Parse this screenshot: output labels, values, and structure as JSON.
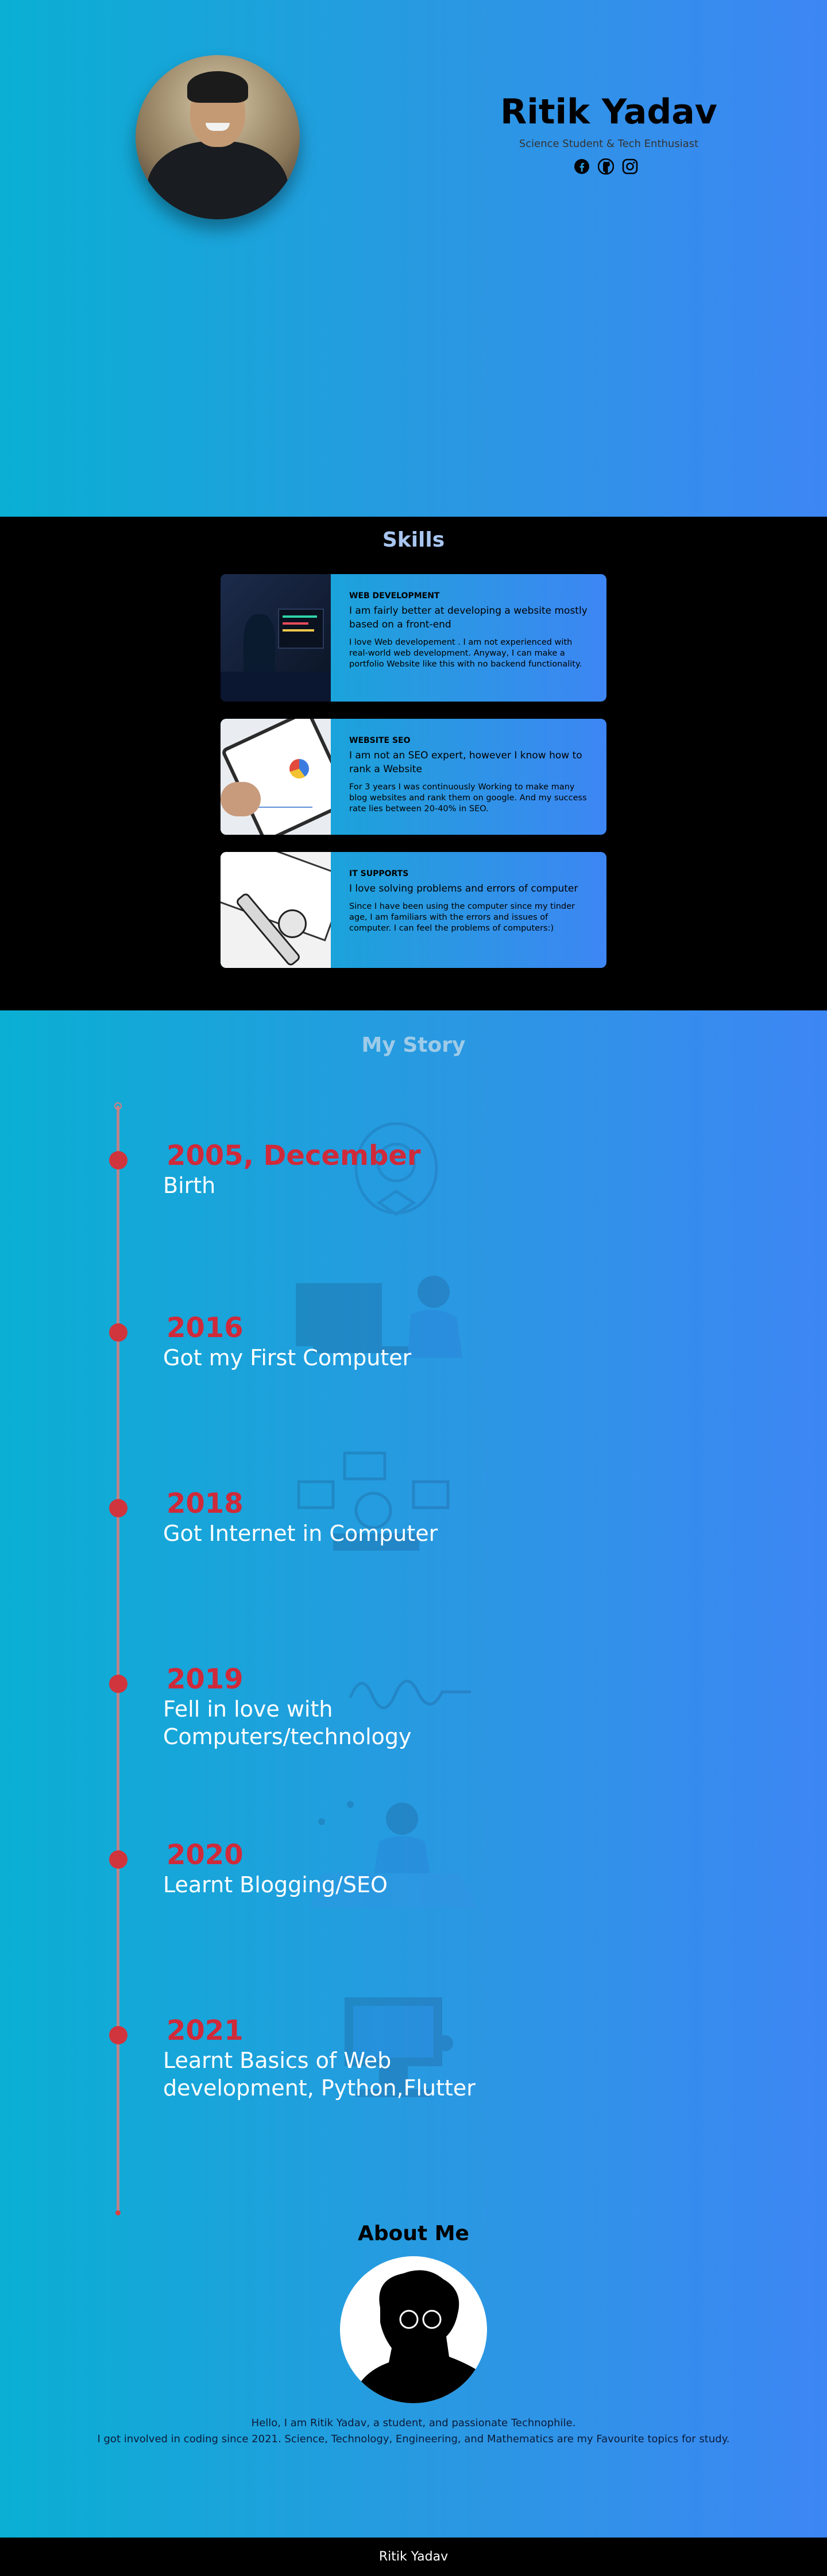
{
  "hero": {
    "name": "Ritik Yadav",
    "tagline": "Science Student & Tech Enthusiast",
    "socials": [
      {
        "name": "facebook-icon"
      },
      {
        "name": "github-icon"
      },
      {
        "name": "instagram-icon"
      }
    ]
  },
  "skills": {
    "title": "Skills",
    "cards": [
      {
        "heading": "WEB DEVELOPMENT",
        "lead": "I am fairly better at developing a website mostly based on a front-end",
        "desc": "I love Web developement . I am not experienced with real-world web development. Anyway, I can make a portfolio Website like this with no backend functionality."
      },
      {
        "heading": "WEBSITE SEO",
        "lead": "I am not an SEO expert, however I know how to rank a Website",
        "desc": "For 3 years I was continuously Working to make many blog websites and rank them on google. And my success rate lies between 20-40% in SEO."
      },
      {
        "heading": "IT SUPPORTS",
        "lead": "I love solving problems and errors of computer",
        "desc": "Since I have been using the computer since my tinder age, I am familiars with the errors and issues of computer. I can feel the problems of computers:)"
      }
    ]
  },
  "story": {
    "title": "My Story",
    "items": [
      {
        "year": "2005, December",
        "event": "Birth"
      },
      {
        "year": "2016",
        "event": "Got my First Computer"
      },
      {
        "year": "2018",
        "event": "Got Internet in Computer"
      },
      {
        "year": "2019",
        "event": "Fell in love with Computers/technology"
      },
      {
        "year": "2020",
        "event": "Learnt Blogging/SEO"
      },
      {
        "year": "2021",
        "event": "Learnt Basics  of Web development, Python,Flutter"
      }
    ]
  },
  "about": {
    "title": "About Me",
    "line1": "Hello, I am Ritik Yadav, a student, and passionate Technophile.",
    "line2": "I got involved in coding since 2021. Science, Technology, Engineering, and Mathematics are my Favourite topics for study."
  },
  "footer": {
    "text": "Ritik Yadav"
  },
  "colors": {
    "gradient_start": "#0aafd3",
    "gradient_end": "#3d86f4",
    "timeline_accent": "#cf2a3a"
  }
}
